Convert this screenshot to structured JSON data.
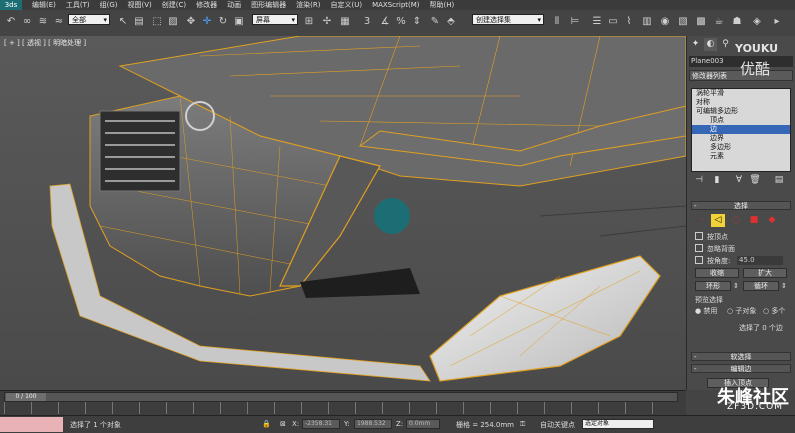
{
  "menu": {
    "logo": "3ds",
    "items": [
      "编辑(E)",
      "工具(T)",
      "组(G)",
      "视图(V)",
      "创建(C)",
      "修改器",
      "动画",
      "图形编辑器",
      "渲染(R)",
      "自定义(U)",
      "MAXScript(M)",
      "帮助(H)"
    ]
  },
  "toolbar": {
    "filter_value": "全部",
    "refcoord_value": "屏幕",
    "selset_value": "创建选择集"
  },
  "viewport": {
    "label": "[ + ] [ 透视 ] [ 明暗处理 ]"
  },
  "cmd_panel": {
    "object_name": "Plane003",
    "modifier_list": "修改器列表",
    "stack": [
      {
        "label": "涡轮平滑",
        "level": 1,
        "selected": false
      },
      {
        "label": "对称",
        "level": 1,
        "selected": false
      },
      {
        "label": "可编辑多边形",
        "level": 1,
        "selected": false
      },
      {
        "label": "顶点",
        "level": 2,
        "selected": false
      },
      {
        "label": "边",
        "level": 2,
        "selected": true
      },
      {
        "label": "边界",
        "level": 2,
        "selected": false
      },
      {
        "label": "多边形",
        "level": 2,
        "selected": false
      },
      {
        "label": "元素",
        "level": 2,
        "selected": false
      }
    ],
    "selection": {
      "header": "选择",
      "by_vertex": "按顶点",
      "ignore_backfacing": "忽略背面",
      "by_angle": "按角度:",
      "angle_value": "45.0",
      "shrink": "收缩",
      "grow": "扩大",
      "ring": "环形",
      "loop": "循环",
      "preview_label": "预览选择",
      "preview_disabled": "禁用",
      "preview_subobj": "子对象",
      "preview_multi": "多个",
      "status": "选择了 0 个边"
    },
    "soft_selection": "软选择",
    "edit_edges": "编辑边",
    "insert_vertex": "插入顶点"
  },
  "timeline": {
    "frame": "0 / 100"
  },
  "statusbar": {
    "message": "选择了 1 个对象",
    "x_label": "X:",
    "x_value": "-2358.31",
    "y_label": "Y:",
    "y_value": "1988.532",
    "z_label": "Z:",
    "z_value": "0.0mm",
    "grid": "栅格 = 254.0mm",
    "autokey": "自动关键点",
    "setkey_mode": "选定对象"
  },
  "watermark": {
    "brand": "朱峰社区",
    "site": "ZF3D.COM",
    "youku1": "YOUKU",
    "youku2": "优酷"
  },
  "colors": {
    "wire": "#e0a020",
    "accent": "#1d6e74",
    "stack_selected": "#3567b6",
    "status_pink": "#e8b2b7"
  }
}
